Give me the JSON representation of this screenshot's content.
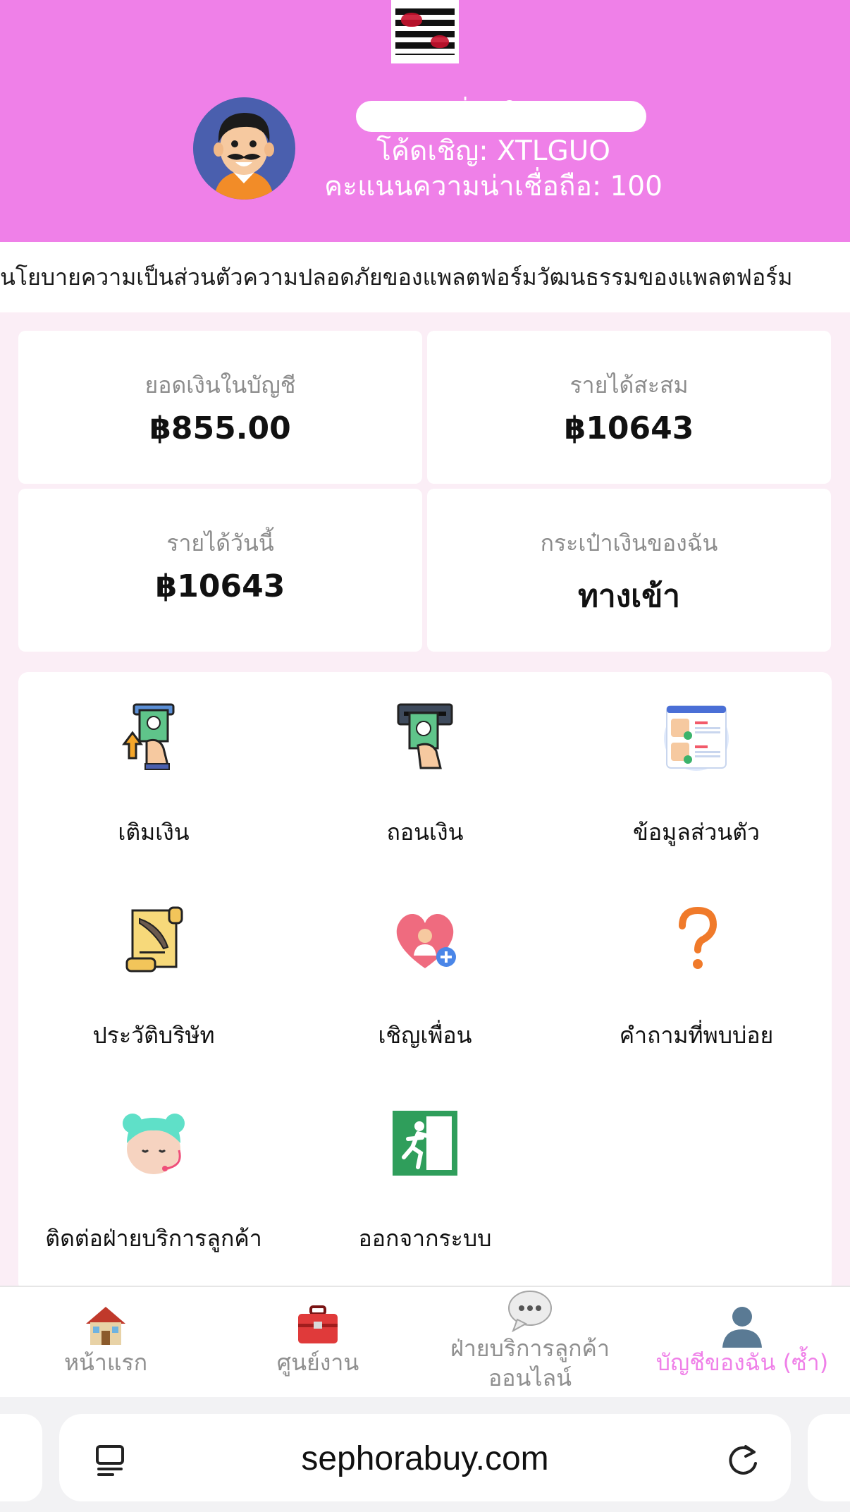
{
  "header": {
    "logo_text": "SEPHORA",
    "username": "ชื่อผู้ใช้",
    "invite_code": "โค้ดเชิญ:  XTLGUO",
    "credit_score": "คะแนนความน่าเชื่อถือ:  100"
  },
  "marquee": {
    "text": "นโยบายความเป็นส่วนตัวความปลอดภัยของแพลตฟอร์มวัฒนธรรมของแพลตฟอร์ม"
  },
  "stats": {
    "balance_label": "ยอดเงินในบัญชี",
    "balance_value": "฿855.00",
    "total_income_label": "รายได้สะสม",
    "total_income_value": "฿10643",
    "today_income_label": "รายได้วันนี้",
    "today_income_value": "฿10643",
    "wallet_label": "กระเป๋าเงินของฉัน",
    "wallet_link": "ทางเข้า"
  },
  "menu": {
    "items": [
      {
        "label": "เติมเงิน",
        "icon": "top-up-icon"
      },
      {
        "label": "ถอนเงิน",
        "icon": "withdraw-icon"
      },
      {
        "label": "ข้อมูลส่วนตัว",
        "icon": "personal-info-icon"
      },
      {
        "label": "ประวัติบริษัท",
        "icon": "scroll-icon"
      },
      {
        "label": "เชิญเพื่อน",
        "icon": "invite-heart-icon"
      },
      {
        "label": "คำถามที่พบบ่อย",
        "icon": "question-icon"
      },
      {
        "label": "ติดต่อฝ่ายบริการลูกค้า",
        "icon": "support-agent-icon"
      },
      {
        "label": "ออกจากระบบ",
        "icon": "exit-icon"
      }
    ]
  },
  "bottom_nav": {
    "items": [
      {
        "label": "หน้าแรก",
        "icon": "house-icon"
      },
      {
        "label": "ศูนย์งาน",
        "icon": "toolbox-icon"
      },
      {
        "label_line1": "ฝ่ายบริการลูกค้า",
        "label_line2": "ออนไลน์",
        "icon": "chat-bubble-icon"
      },
      {
        "label": "บัญชีของฉัน (ซ้ำ)",
        "icon": "user-silhouette-icon"
      }
    ],
    "active_color": "#ef80e8",
    "inactive_color": "#8f8f8f"
  },
  "browser": {
    "url": "sephorabuy.com",
    "reader_icon": "reader-icon",
    "reload_icon": "reload-icon"
  },
  "colors": {
    "header_bg": "#ef80e8",
    "page_bg": "#fbeef6"
  }
}
